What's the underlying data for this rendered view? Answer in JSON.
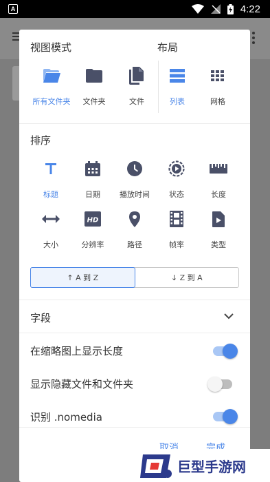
{
  "status_bar": {
    "time": "4:22",
    "app_icon": "A"
  },
  "dialog": {
    "view_mode": {
      "title": "视图模式",
      "options": [
        {
          "label": "所有文件夹",
          "icon": "folder-open-icon",
          "active": true
        },
        {
          "label": "文件夹",
          "icon": "folder-icon",
          "active": false
        },
        {
          "label": "文件",
          "icon": "file-copy-icon",
          "active": false
        }
      ]
    },
    "layout": {
      "title": "布局",
      "options": [
        {
          "label": "列表",
          "icon": "list-icon",
          "active": true
        },
        {
          "label": "网格",
          "icon": "grid-icon",
          "active": false
        }
      ]
    },
    "sort": {
      "title": "排序",
      "options": [
        {
          "label": "标题",
          "icon": "title-icon",
          "active": true
        },
        {
          "label": "日期",
          "icon": "calendar-icon",
          "active": false
        },
        {
          "label": "播放时间",
          "icon": "clock-icon",
          "active": false
        },
        {
          "label": "状态",
          "icon": "play-status-icon",
          "active": false
        },
        {
          "label": "长度",
          "icon": "ruler-icon",
          "active": false
        },
        {
          "label": "大小",
          "icon": "resize-icon",
          "active": false
        },
        {
          "label": "分辨率",
          "icon": "hd-icon",
          "active": false
        },
        {
          "label": "路径",
          "icon": "location-pin-icon",
          "active": false
        },
        {
          "label": "帧率",
          "icon": "film-icon",
          "active": false
        },
        {
          "label": "类型",
          "icon": "file-type-icon",
          "active": false
        }
      ],
      "order_asc": "↑ A 到 Z",
      "order_desc": "↓ Z 到 A",
      "selected_order": "asc"
    },
    "fields": {
      "label": "字段"
    },
    "settings": [
      {
        "label": "在缩略图上显示长度",
        "on": true
      },
      {
        "label": "显示隐藏文件和文件夹",
        "on": false
      },
      {
        "label": "识别 .nomedia",
        "on": true
      }
    ],
    "cancel_label": "取消",
    "done_label": "完成"
  },
  "watermark": {
    "text": "巨型手游网"
  },
  "colors": {
    "accent": "#4a86e8",
    "icon_dark": "#4a5068"
  }
}
